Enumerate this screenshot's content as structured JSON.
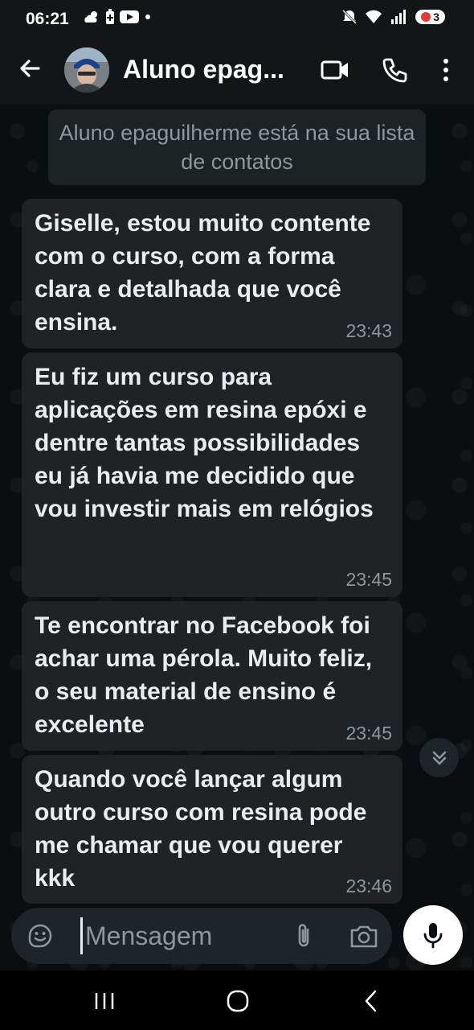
{
  "status_bar": {
    "time": "06:21",
    "left_icons": [
      "cloud-sun-icon",
      "battery-saver-icon",
      "youtube-icon",
      "dot-icon"
    ],
    "right_icons": [
      "mute-icon",
      "wifi-icon",
      "signal-icon"
    ],
    "notification_count": "3"
  },
  "header": {
    "contact_name": "Aluno epag...",
    "icons": [
      "back-arrow-icon",
      "video-call-icon",
      "phone-icon",
      "more-vertical-icon"
    ]
  },
  "system_notice": "Aluno epaguilherme está na sua lista de contatos",
  "messages": [
    {
      "text": "Giselle, estou muito contente com o curso, com a forma clara e detalhada que você ensina.",
      "time": "23:43"
    },
    {
      "text": "Eu fiz um curso para aplicações em resina epóxi e dentre tantas possibilidades eu já havia me decidido que vou investir mais em relógios",
      "time": "23:45"
    },
    {
      "text": "Te encontrar no Facebook foi achar uma pérola. Muito feliz, o seu material de ensino é excelente",
      "time": "23:45"
    },
    {
      "text": "Quando você lançar algum outro curso com resina pode me chamar que vou querer kkk",
      "time": "23:46"
    }
  ],
  "composer": {
    "placeholder": "Mensagem",
    "icons": [
      "sticker-icon",
      "attach-icon",
      "camera-icon",
      "mic-icon"
    ]
  },
  "colors": {
    "background": "#0b0e10",
    "bubble": "#1f2326",
    "header": "#121619",
    "text": "#e9edef",
    "secondary_text": "#8d979c"
  }
}
